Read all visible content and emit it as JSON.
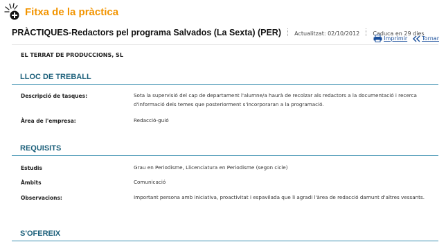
{
  "header": {
    "title": "Fitxa de la pràctica",
    "accent_color": "#f29400"
  },
  "offer": {
    "title": "PRÀCTIQUES-Redactors pel programa Salvados (La Sexta) (PER)",
    "updated": "Actualitzat: 02/10/2012",
    "expires": "Caduca en 29 dies"
  },
  "actions": {
    "print_label": "Imprimir",
    "back_label": "Tornar"
  },
  "company": "EL TERRAT DE PRODUCCIONS, SL",
  "sections": {
    "lloc": {
      "title": "LLOC DE TREBALL",
      "rows": [
        {
          "label": "Descripció de tasques:",
          "value": "Sota la supervisió del cap de departament l'alumne/a haurà de recolzar als redactors a la documentació i recerca d'informació dels temes que posteriorment s'incorporaran a la programació."
        },
        {
          "label": "Àrea de l'empresa:",
          "value": "Redacció-guió"
        }
      ]
    },
    "requisits": {
      "title": "REQUISITS",
      "rows": [
        {
          "label": "Estudis",
          "value": "Grau en Periodisme, Llicenciatura en Periodisme (segon cicle)"
        },
        {
          "label": "Àmbits",
          "value": "Comunicació"
        },
        {
          "label": "Observacions:",
          "value": "Important persona amb iniciativa, proactivitat i espavilada que li agradi l'àrea de redacció damunt d'altres vessants."
        }
      ]
    },
    "ofereix": {
      "title": "S'OFEREIX"
    }
  },
  "colors": {
    "section_title": "#1b5f7a",
    "section_rule": "#3a8fb0",
    "link": "#1a4f9c"
  }
}
